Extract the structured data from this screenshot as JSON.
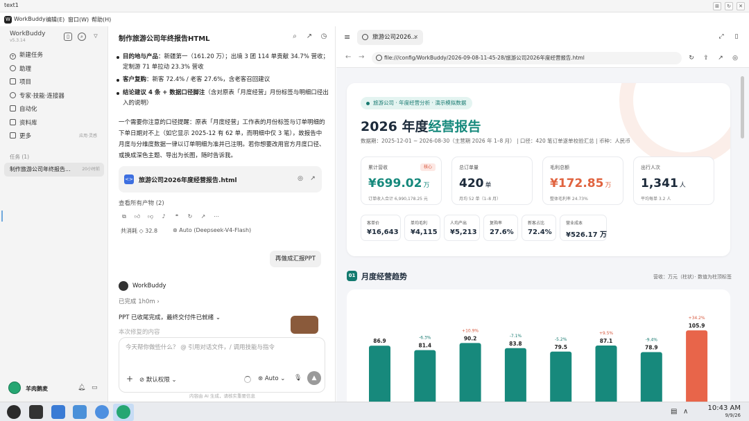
{
  "window": {
    "title": "text1"
  },
  "app": {
    "name": "WorkBuddy",
    "menu": [
      "编辑(E)",
      "窗口(W)",
      "帮助(H)"
    ]
  },
  "sidebar": {
    "name": "WorkBuddy",
    "version": "v5.3.14",
    "items": [
      {
        "label": "新建任务",
        "icon": "plus-icon"
      },
      {
        "label": "助理",
        "icon": "assistant-icon"
      },
      {
        "label": "项目",
        "icon": "folder-icon"
      },
      {
        "label": "专家·技能·连接器",
        "icon": "expert-icon"
      },
      {
        "label": "自动化",
        "icon": "clock-icon"
      },
      {
        "label": "资料库",
        "icon": "library-icon"
      },
      {
        "label": "更多",
        "icon": "more-icon",
        "meta": "应用·灵感"
      }
    ],
    "tasks_header": "任务 (1)",
    "task": {
      "label": "制作旅游公司年终报告...",
      "time": "20小时前"
    },
    "user": "羊肉鹅麦"
  },
  "chat": {
    "title": "制作旅游公司年终报告HTML",
    "bullets": [
      {
        "bold": "目的地与产品",
        "text": "：新疆第一（161.20 万）；出境 3 团 114 单贡献 34.7% 营收；定制游 71 单拉动 23.3% 营收"
      },
      {
        "bold": "客户复购",
        "text": "：新客 72.4% / 老客 27.6%，含老客召回建议"
      },
      {
        "bold": "结论建议 4 条 + 数据口径脚注",
        "text": "（含对原表「月度经营」月份标签与明细口径出入的说明）"
      }
    ],
    "paragraph": "一个需要你注意的口径提醒：原表「月度经营」工作表的月份标签与订单明细的下单日期对不上（如它显示 2025-12 有 62 单，而明细中仅 3 笔），故报告中月度与分维度数据一律以订单明细为准并已注明。若你想要改用官方月度口径、或换成深色主题、导出为长图，随时告诉我。",
    "file_name": "旅游公司2026年度经营报告.html",
    "all_products": "查看所有产物 (2)",
    "cost": "共消耗 ◇ 32.8",
    "model": "Auto (Deepseek-V4-Flash)",
    "user_message": "再做成汇报PPT",
    "assistant_name": "WorkBuddy",
    "status": "已完成 1h0m",
    "final_text": "PPT 已收尾完成，最终交付件已就绪",
    "faded_text": "本次修复的内容",
    "input_placeholder": "今天帮你做些什么？ @ 引用对话文件，/ 调用技能与指令",
    "permission": "默认权限",
    "auto": "Auto",
    "disclaimer": "内容由 AI 生成，请核实重要信息"
  },
  "browser": {
    "tab_title": "旅游公司2026...",
    "url": "file:///config/WorkBuddy/2026-09-08-11-45-28/旅游公司2026年度经营报告.html"
  },
  "report": {
    "pill": "旅游公司 · 年度经营分析 · 演示模拟数据",
    "title_main": "2026 年度",
    "title_accent": "经营报告",
    "subtitle": "数据期：2025-12-01 ~ 2026-08-30（主营期 2026 年 1–8 月）  |  口径：420 笔订单逐单校验汇总  |  币种：人民币",
    "kpis": [
      {
        "label": "累计营收",
        "tag": "核心",
        "value": "¥699.02",
        "unit": "万",
        "note": "订单收入合计 6,990,178.25 元",
        "color": "#16897c"
      },
      {
        "label": "总订单量",
        "tag": "",
        "value": "420",
        "unit": "单",
        "note": "月均 52 单（1–8 月）",
        "color": "#1c2a3a"
      },
      {
        "label": "毛利总额",
        "tag": "",
        "value": "¥172.85",
        "unit": "万",
        "note": "整体毛利率 24.73%",
        "color": "#e0633f"
      },
      {
        "label": "出行人次",
        "tag": "",
        "value": "1,341",
        "unit": "人",
        "note": "平均每单 3.2 人",
        "color": "#1c2a3a"
      }
    ],
    "minis": [
      {
        "label": "客单价",
        "value": "¥16,643"
      },
      {
        "label": "单均毛利",
        "value": "¥4,115"
      },
      {
        "label": "人均产出",
        "value": "¥5,213"
      },
      {
        "label": "复购率",
        "value": "27.6%"
      },
      {
        "label": "新客占比",
        "value": "72.4%"
      },
      {
        "label": "营业成本",
        "value": "¥526.17 万"
      }
    ],
    "section_num": "01",
    "section_title": "月度经营趋势",
    "section_note": "营收：万元（柱状）· 数值为柱顶标签"
  },
  "chart_data": {
    "type": "bar",
    "categories": [
      "1 月",
      "2 月",
      "3 月",
      "4 月",
      "5 月",
      "6 月",
      "7 月",
      "8 月"
    ],
    "values": [
      86.9,
      81.4,
      90.2,
      83.8,
      79.5,
      87.1,
      78.9,
      105.9
    ],
    "changes": [
      "",
      "-6.3%",
      "+10.9%",
      "-7.1%",
      "-5.2%",
      "+9.5%",
      "-9.4%",
      "+34.2%"
    ],
    "ylabel": "万元",
    "colors": {
      "bar": "#17897c",
      "highlight": "#e8654a",
      "up": "#d6573c",
      "down": "#16796f"
    }
  },
  "taskbar": {
    "time": "10:43 AM",
    "date": "9/9/26"
  }
}
